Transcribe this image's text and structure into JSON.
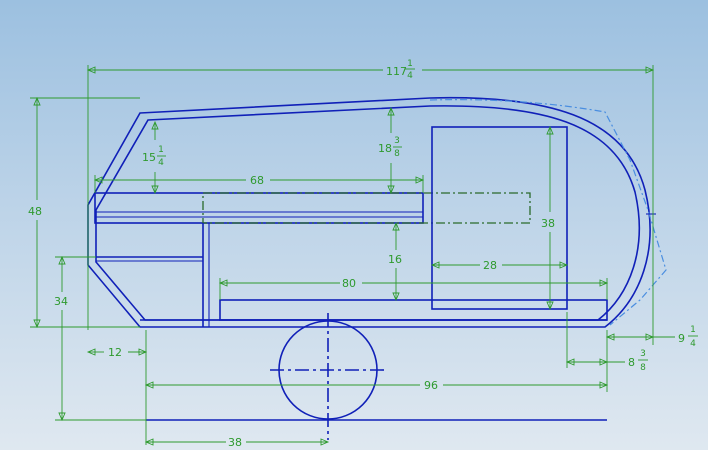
{
  "colors": {
    "geometry": "#1020b8",
    "dimension": "#2e9a2e",
    "ghost_outline": "#4a8ee0",
    "hidden_line": "#2a6a2a"
  },
  "dimensions": {
    "overall_length": {
      "whole": "117",
      "num": "1",
      "den": "4"
    },
    "height": "48",
    "roof_drop_front": {
      "whole": "15",
      "num": "1",
      "den": "4"
    },
    "roof_drop_mid": {
      "whole": "18",
      "num": "3",
      "den": "8"
    },
    "cabinet_length": "68",
    "door_height": "38",
    "bed_height": "16",
    "door_width": "28",
    "floor_length": "80",
    "front_lower_height": "34",
    "front_offset": "12",
    "wheelbase_length": "96",
    "wheel_offset": "38",
    "rear_overhang_a": {
      "whole": "9",
      "num": "1",
      "den": "4"
    },
    "rear_overhang_b": {
      "whole": "8",
      "num": "3",
      "den": "8"
    }
  }
}
